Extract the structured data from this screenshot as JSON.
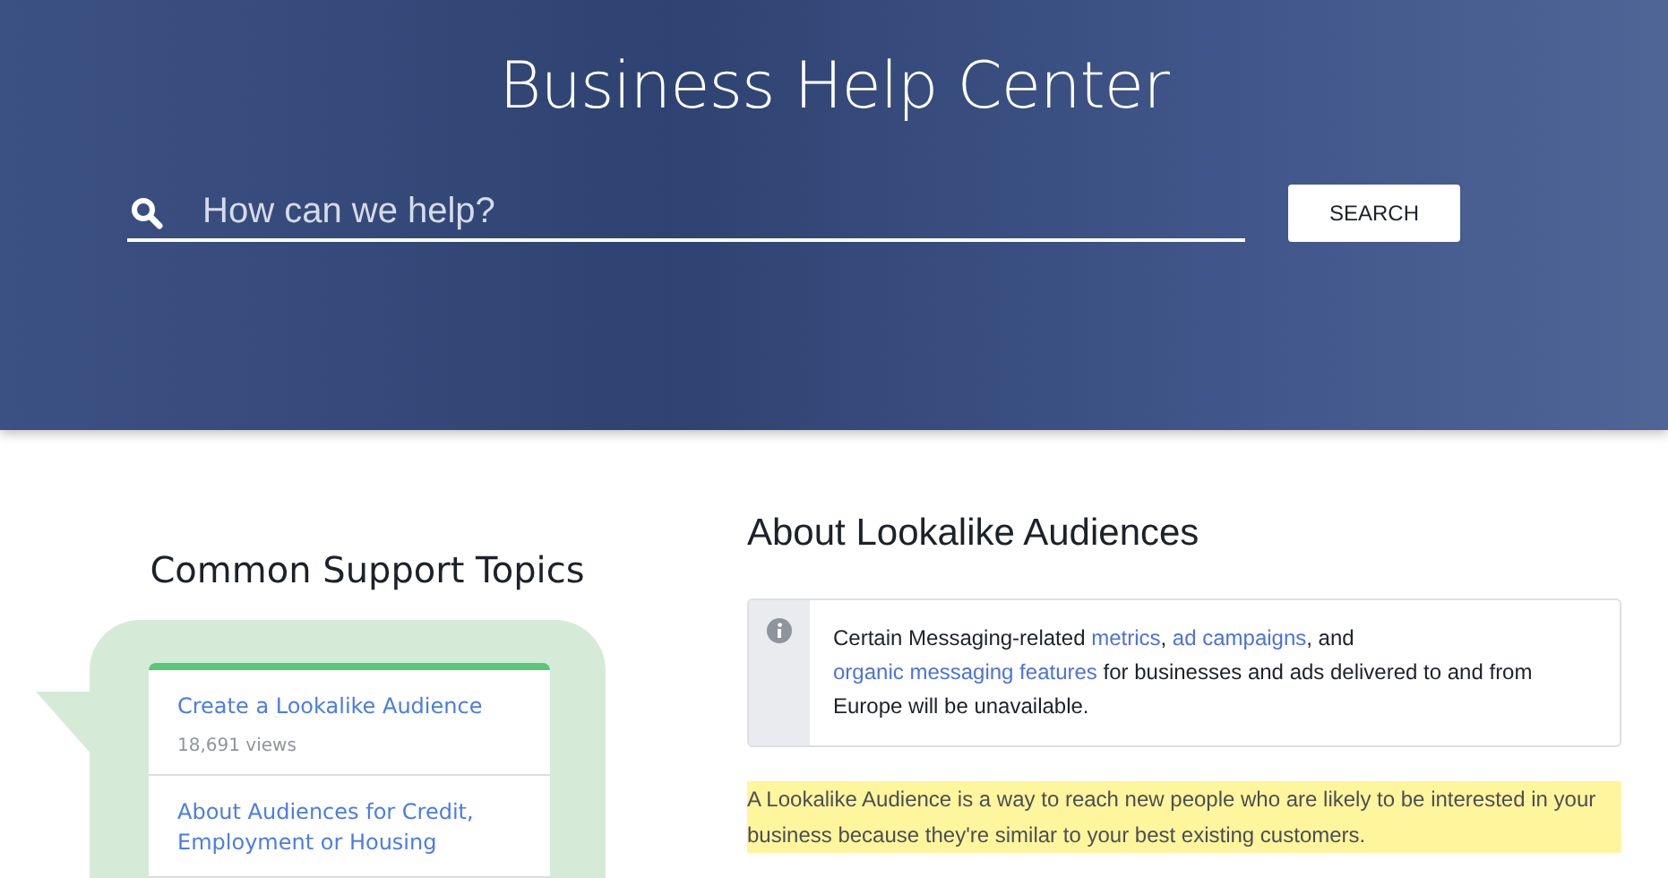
{
  "header": {
    "title": "Business Help Center",
    "search": {
      "placeholder": "How can we help?"
    },
    "search_button": "SEARCH"
  },
  "sidebar": {
    "title": "Common Support Topics",
    "topics": [
      {
        "title": "Create a Lookalike Audience",
        "views": "18,691 views"
      },
      {
        "title": "About Audiences for Credit, Employment or Housing"
      }
    ]
  },
  "article": {
    "title": "About Lookalike Audiences",
    "notice": [
      {
        "kind": "text",
        "text": "Certain Messaging-related "
      },
      {
        "kind": "link",
        "text": "metrics"
      },
      {
        "kind": "text",
        "text": ", "
      },
      {
        "kind": "link",
        "text": "ad campaigns"
      },
      {
        "kind": "text",
        "text": ", and "
      },
      {
        "kind": "link",
        "text": "organic messaging features"
      },
      {
        "kind": "text",
        "text": " for businesses and ads delivered to and from Europe will be unavailable."
      }
    ],
    "intro": "A Lookalike Audience is a way to reach new people who are likely to be interested in your business because they're similar to your best existing customers."
  }
}
